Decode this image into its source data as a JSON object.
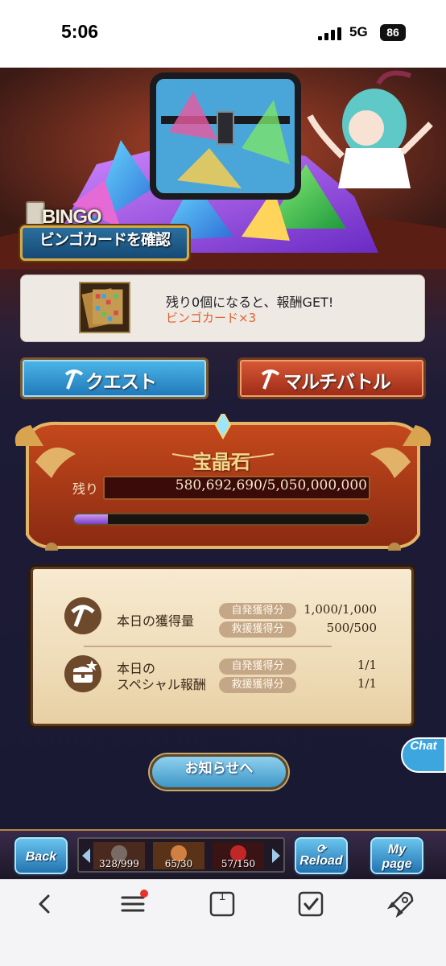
{
  "status_bar": {
    "time": "5:06",
    "network": "5G",
    "battery": "86"
  },
  "bingo": {
    "logo_text": "BINGO",
    "button_label": "ビンゴカードを確認",
    "reward_text": "残り0個になると、報酬GET!",
    "reward_item": "ビンゴカード×3"
  },
  "actions": {
    "quest_label": "クエスト",
    "multibattle_label": "マルチバトル"
  },
  "crystal_panel": {
    "title": "宝晶石",
    "remaining_label": "残り",
    "remaining_value": "580,692,690/5,050,000,000",
    "progress": 0.115
  },
  "info_board": {
    "row1": {
      "label": "本日の獲得量",
      "tags": [
        "自発獲得分",
        "救援獲得分"
      ],
      "values": [
        "1,000/1,000",
        "500/500"
      ]
    },
    "row2": {
      "label_line1": "本日の",
      "label_line2": "スペシャル報酬",
      "tags": [
        "自発獲得分",
        "救援獲得分"
      ],
      "values": [
        "1/1",
        "1/1"
      ]
    }
  },
  "notice_button_label": "お知らせへ",
  "chat_label": "Chat",
  "game_nav": {
    "back": "Back",
    "reload": "Reload",
    "mypage_line1": "My",
    "mypage_line2": "page",
    "resources": [
      "328/999",
      "65/30",
      "57/150"
    ]
  },
  "browser": {
    "tab_count": "1"
  },
  "colors": {
    "accent_blue": "#3ea6df",
    "accent_red": "#c0391f",
    "reward_orange": "#e0602c"
  }
}
